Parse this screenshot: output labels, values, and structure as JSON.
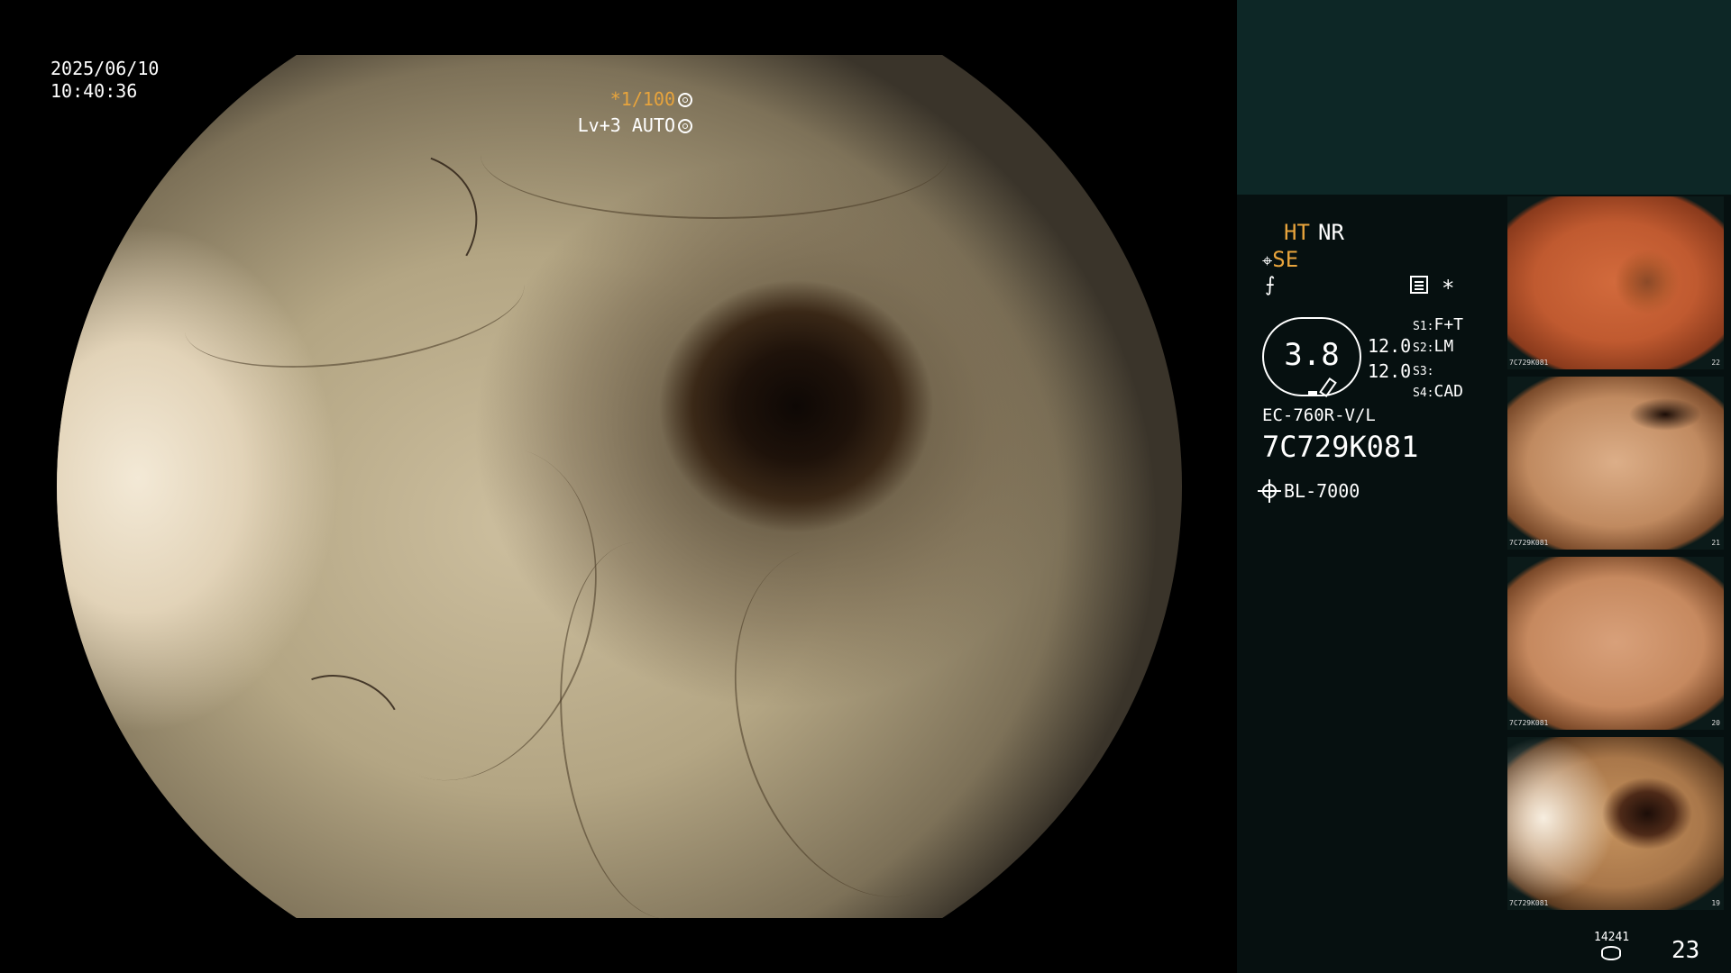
{
  "overlay": {
    "date": "2025/06/10",
    "time": "10:40:36",
    "shutter": "*1/100",
    "level": "Lv+3 AUTO"
  },
  "processor": {
    "ht": "HT",
    "nr": "NR",
    "se": "SE",
    "se_icon": "scope-tip-icon",
    "f_icon": "f-symbol-icon",
    "asterisk": "*",
    "zoom": "3.8",
    "value_a": "12.0",
    "value_b": "12.0",
    "slots": [
      {
        "key": "S1:",
        "value": "F+T"
      },
      {
        "key": "S2:",
        "value": "LM"
      },
      {
        "key": "S3:",
        "value": ""
      },
      {
        "key": "S4:",
        "value": "CAD"
      }
    ],
    "scope_model": "EC-760R-V/L",
    "serial": "7C729K081",
    "light_source": "BL-7000"
  },
  "thumbnails": [
    {
      "caption": "7C729K081",
      "number": "22"
    },
    {
      "caption": "7C729K081",
      "number": "21"
    },
    {
      "caption": "7C729K081",
      "number": "20"
    },
    {
      "caption": "7C729K081",
      "number": "19"
    }
  ],
  "footer": {
    "storage_count": "14241",
    "image_count": "23"
  },
  "colors": {
    "accent": "#e8a43c",
    "panel_top": "#0d2726",
    "panel": "#061010"
  }
}
